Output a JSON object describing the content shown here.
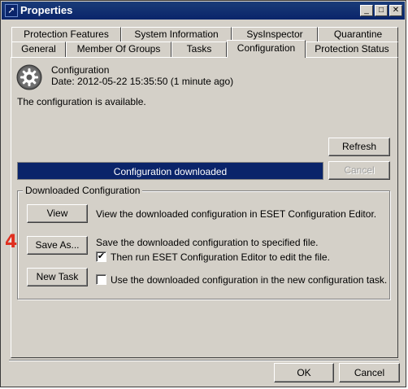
{
  "window": {
    "title": "Properties",
    "controls": {
      "minimize": "_",
      "maximize": "□",
      "close": "✕"
    }
  },
  "tabs": {
    "row1": [
      "Protection Features",
      "System Information",
      "SysInspector",
      "Quarantine"
    ],
    "row2": [
      "General",
      "Member Of Groups",
      "Tasks",
      "Configuration",
      "Protection Status"
    ],
    "active": "Configuration"
  },
  "config": {
    "icon": "gear-icon",
    "name": "Configuration",
    "date": "Date: 2012-05-22 15:35:50 (1 minute ago)",
    "status": "The configuration is available."
  },
  "buttons": {
    "refresh": "Refresh",
    "cancel_progress": "Cancel",
    "view": "View",
    "save_as": "Save As...",
    "new_task": "New Task",
    "ok": "OK",
    "cancel": "Cancel"
  },
  "progress": {
    "label": "Configuration downloaded",
    "fraction": 1.0
  },
  "downloaded": {
    "group_label": "Downloaded Configuration",
    "view_desc": "View the downloaded configuration in ESET Configuration Editor.",
    "save_desc": "Save the downloaded configuration to specified file.",
    "run_editor_label": "Then run ESET Configuration Editor to edit the file.",
    "run_editor_checked": true,
    "new_task_label": "Use the downloaded configuration in the new configuration task.",
    "new_task_checked": false
  },
  "annotation": {
    "step": "4",
    "color": "#e03020"
  },
  "colors": {
    "titlebar": "#0a246a",
    "progress": "#0a246a",
    "face": "#d4d0c8"
  }
}
